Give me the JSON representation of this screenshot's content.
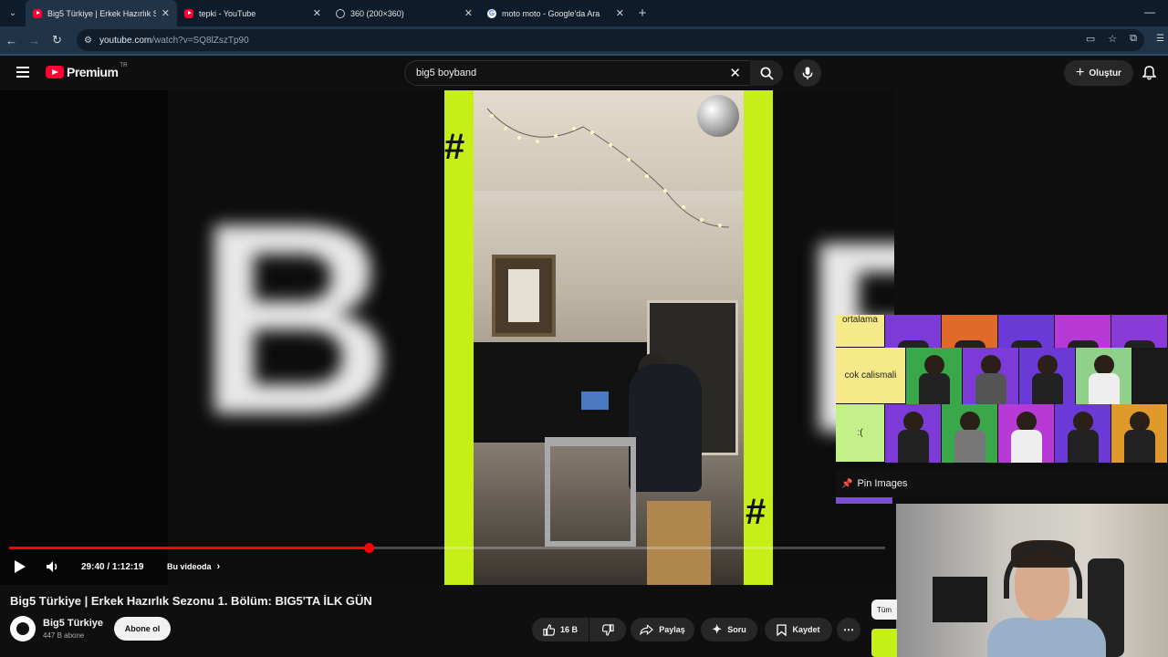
{
  "browser": {
    "tabs": [
      {
        "title": "Big5 Türkiye | Erkek Hazırlık Se",
        "favicon": "youtube-icon",
        "active": true
      },
      {
        "title": "tepki - YouTube",
        "favicon": "youtube-icon",
        "active": false
      },
      {
        "title": "360 (200×360)",
        "favicon": "globe-icon",
        "active": false
      },
      {
        "title": "moto moto - Google'da Ara",
        "favicon": "google-icon",
        "active": false
      }
    ],
    "new_tab": "+",
    "url_host": "youtube.com",
    "url_path": "/watch?v=SQ8lZszTp90"
  },
  "youtube": {
    "logo_text": "Premium",
    "logo_region": "TR",
    "search_query": "big5 boyband",
    "create_label": "Oluştur"
  },
  "player": {
    "time": "29:40 / 1:12:19",
    "chapter_label": "Bu videoda",
    "progress_fraction": 0.41,
    "left_letter": "B",
    "right_letter": "B"
  },
  "overlay": {
    "tiers": [
      {
        "label": "ortalama"
      },
      {
        "label": "cok calismali"
      },
      {
        "label": ":("
      }
    ],
    "pin_label": "Pin Images"
  },
  "video_info": {
    "title": "Big5 Türkiye | Erkek Hazırlık Sezonu 1. Bölüm: BIG5'TA İLK GÜN",
    "channel": "Big5 Türkiye",
    "subscribers": "447 B abone",
    "subscribe_label": "Abone ol",
    "likes": "16 B",
    "share_label": "Paylaş",
    "ask_label": "Soru",
    "save_label": "Kaydet",
    "side_chip": "Tüm"
  },
  "colors": {
    "accent_red": "#ff0033",
    "neon_green": "#c6ef17",
    "progress_red": "#ff0000"
  }
}
